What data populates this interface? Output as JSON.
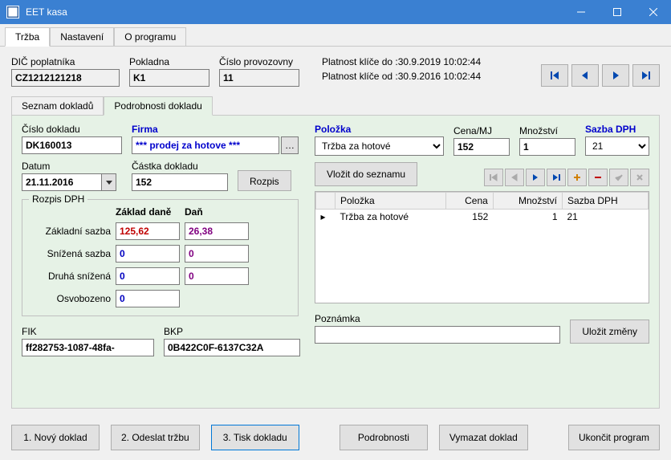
{
  "window": {
    "title": "EET kasa"
  },
  "main_tabs": [
    {
      "label": "Tržba",
      "active": true
    },
    {
      "label": "Nastavení",
      "active": false
    },
    {
      "label": "O programu",
      "active": false
    }
  ],
  "header": {
    "dic_label": "DIČ poplatníka",
    "dic": "CZ1212121218",
    "pokladna_label": "Pokladna",
    "pokladna": "K1",
    "provozovna_label": "Číslo provozovny",
    "provozovna": "11",
    "validity_to": "Platnost klíče do :30.9.2019 10:02:44",
    "validity_from": "Platnost klíče od :30.9.2016 10:02:44"
  },
  "sub_tabs": [
    {
      "label": "Seznam dokladů",
      "active": false
    },
    {
      "label": "Podrobnosti dokladu",
      "active": true
    }
  ],
  "doc": {
    "cislo_label": "Číslo dokladu",
    "cislo": "DK160013",
    "firma_label": "Firma",
    "firma": "*** prodej za hotove ***",
    "datum_label": "Datum",
    "datum": "21.11.2016",
    "castka_label": "Částka dokladu",
    "castka": "152",
    "rozpis_btn": "Rozpis"
  },
  "item": {
    "polozka_label": "Položka",
    "polozka": "Tržba za hotové",
    "cena_label": "Cena/MJ",
    "cena": "152",
    "mnozstvi_label": "Množství",
    "mnozstvi": "1",
    "sazba_label": "Sazba DPH",
    "sazba": "21",
    "vlozit_btn": "Vložit do seznamu"
  },
  "dph": {
    "title": "Rozpis DPH",
    "zaklad_hdr": "Základ daně",
    "dan_hdr": "Daň",
    "rows": [
      {
        "label": "Základní sazba",
        "zaklad": "125,62",
        "dan": "26,38"
      },
      {
        "label": "Snížená sazba",
        "zaklad": "0",
        "dan": "0"
      },
      {
        "label": "Druhá snížená",
        "zaklad": "0",
        "dan": "0"
      },
      {
        "label": "Osvobozeno",
        "zaklad": "0",
        "dan": ""
      }
    ]
  },
  "codes": {
    "fik_label": "FIK",
    "fik": "ff282753-1087-48fa-",
    "bkp_label": "BKP",
    "bkp": "0B422C0F-6137C32A"
  },
  "gridcols": {
    "polozka": "Položka",
    "cena": "Cena",
    "mnozstvi": "Množství",
    "sazba": "Sazba DPH"
  },
  "gridrows": [
    {
      "polozka": "Tržba za hotové",
      "cena": "152",
      "mnozstvi": "1",
      "sazba": "21"
    }
  ],
  "note": {
    "label": "Poznámka",
    "value": ""
  },
  "save_btn": "Uložit změny",
  "bottom": {
    "b1": "1. Nový doklad",
    "b2": "2. Odeslat tržbu",
    "b3": "3. Tisk dokladu",
    "b4": "Podrobnosti",
    "b5": "Vymazat doklad",
    "b6": "Ukončit program"
  }
}
